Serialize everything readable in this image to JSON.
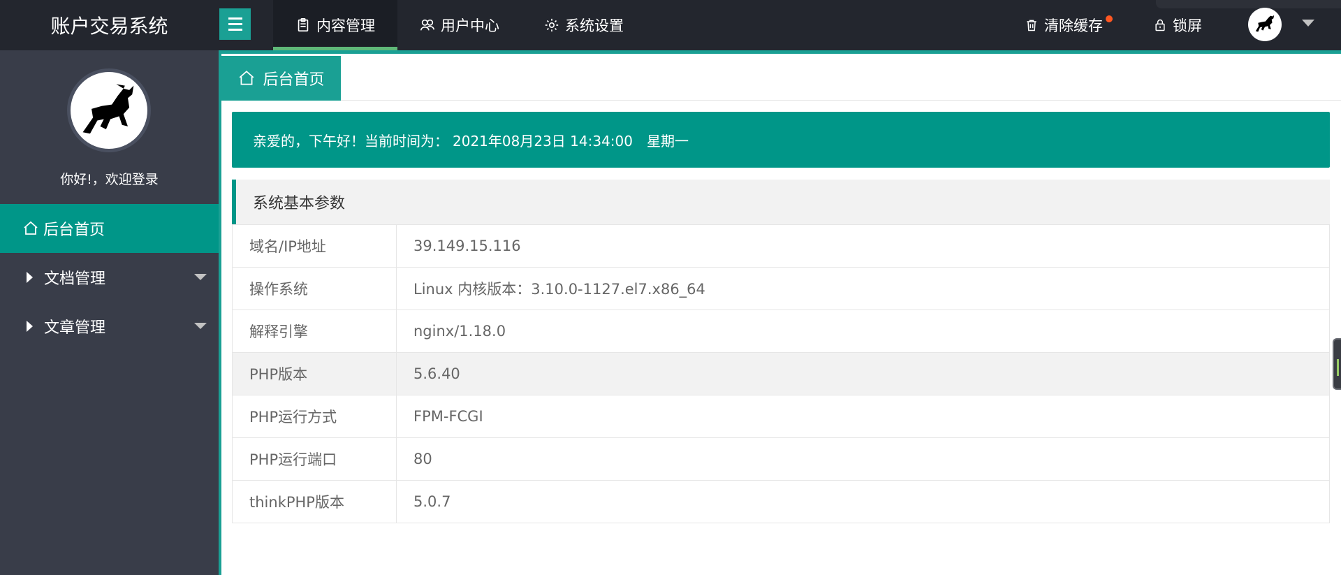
{
  "app": {
    "title": "账户交易系统"
  },
  "header": {
    "nav": [
      {
        "label": "内容管理",
        "icon": "clipboard-icon",
        "active": true
      },
      {
        "label": "用户中心",
        "icon": "users-icon",
        "active": false
      },
      {
        "label": "系统设置",
        "icon": "gear-icon",
        "active": false
      }
    ],
    "clear_cache_label": "清除缓存",
    "lock_label": "锁屏"
  },
  "sidebar": {
    "welcome": "你好!，欢迎登录",
    "items": [
      {
        "label": "后台首页",
        "icon": "home-icon",
        "active": true
      },
      {
        "label": "文档管理",
        "icon": "caret-right-icon",
        "active": false
      },
      {
        "label": "文章管理",
        "icon": "caret-right-icon",
        "active": false
      }
    ]
  },
  "tabs": [
    {
      "label": "后台首页",
      "icon": "home-icon"
    }
  ],
  "greeting": {
    "prefix": "亲爱的，下午好！当前时间为：",
    "datetime": "2021年08月23日 14:34:00",
    "weekday": "星期一"
  },
  "system_info": {
    "title": "系统基本参数",
    "rows": [
      {
        "key": "域名/IP地址",
        "value": "39.149.15.116"
      },
      {
        "key": "操作系统",
        "value": "Linux 内核版本：3.10.0-1127.el7.x86_64"
      },
      {
        "key": "解释引擎",
        "value": "nginx/1.18.0"
      },
      {
        "key": "PHP版本",
        "value": "5.6.40"
      },
      {
        "key": "PHP运行方式",
        "value": "FPM-FCGI"
      },
      {
        "key": "PHP运行端口",
        "value": "80"
      },
      {
        "key": "thinkPHP版本",
        "value": "5.0.7"
      }
    ]
  },
  "colors": {
    "accent": "#009688",
    "header": "#23262e",
    "sidebar": "#393d49",
    "tab": "#1aa094",
    "badge": "#ff5722"
  }
}
